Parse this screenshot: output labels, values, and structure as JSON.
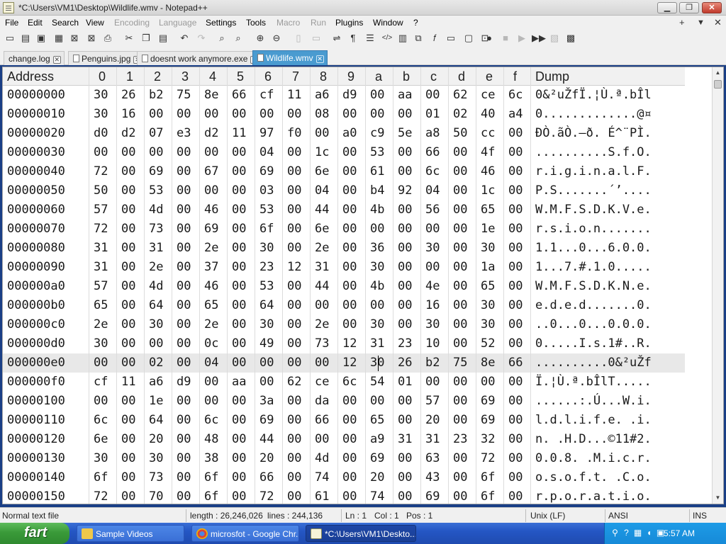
{
  "window": {
    "title": "*C:\\Users\\VM1\\Desktop\\Wildlife.wmv - Notepad++",
    "minimize_label": "▁",
    "restore_label": "❐",
    "close_label": "✕"
  },
  "menu": {
    "items": [
      "File",
      "Edit",
      "Search",
      "View",
      "Encoding",
      "Language",
      "Settings",
      "Tools",
      "Macro",
      "Run",
      "Plugins",
      "Window",
      "?"
    ],
    "disabled": [
      "Encoding",
      "Language",
      "Macro",
      "Run"
    ],
    "plus_label": "+",
    "dropdown_label": "▼",
    "close_label": "✕"
  },
  "toolbar": {
    "icons": [
      "new-file-icon",
      "open-file-icon",
      "save-icon",
      "save-all-icon",
      "close-icon",
      "close-all-icon",
      "print-icon",
      "cut-icon",
      "copy-icon",
      "paste-icon",
      "undo-icon",
      "redo-icon",
      "find-icon",
      "replace-icon",
      "zoom-in-icon",
      "zoom-out-icon",
      "sync-vertical-icon",
      "sync-horizontal-icon",
      "word-wrap-icon",
      "show-all-chars-icon",
      "indent-guide-icon",
      "xml-tag-icon",
      "document-map-icon",
      "function-list-icon",
      "folder-workspace-icon",
      "monitoring-icon",
      "fx-icon",
      "screen-icon",
      "record-macro-icon",
      "stop-record-icon",
      "play-macro-icon",
      "run-macro-multiple-icon",
      "save-macro-icon",
      "hex-editor-icon"
    ]
  },
  "tabs": [
    {
      "label": "change.log",
      "close": "✕"
    },
    {
      "label": "Penguins.jpg",
      "close": "✕"
    },
    {
      "label": "doesnt work anymore.exe",
      "close": "✕"
    },
    {
      "label": "Wildlife.wmv",
      "close": "✕"
    }
  ],
  "hex": {
    "header": {
      "address": "Address",
      "columns": [
        "0",
        "1",
        "2",
        "3",
        "4",
        "5",
        "6",
        "7",
        "8",
        "9",
        "a",
        "b",
        "c",
        "d",
        "e",
        "f"
      ],
      "dump": "Dump"
    },
    "rows": [
      {
        "addr": "00000000",
        "bytes": [
          "30",
          "26",
          "b2",
          "75",
          "8e",
          "66",
          "cf",
          "11",
          "a6",
          "d9",
          "00",
          "aa",
          "00",
          "62",
          "ce",
          "6c"
        ],
        "dump": "0&²uŽfÏ.¦Ù.ª.bÎl"
      },
      {
        "addr": "00000010",
        "bytes": [
          "30",
          "16",
          "00",
          "00",
          "00",
          "00",
          "00",
          "00",
          "08",
          "00",
          "00",
          "00",
          "01",
          "02",
          "40",
          "a4"
        ],
        "dump": "0.............@¤"
      },
      {
        "addr": "00000020",
        "bytes": [
          "d0",
          "d2",
          "07",
          "e3",
          "d2",
          "11",
          "97",
          "f0",
          "00",
          "a0",
          "c9",
          "5e",
          "a8",
          "50",
          "cc",
          "00"
        ],
        "dump": "ÐÒ.ãÒ.—ð. É^¨PÌ."
      },
      {
        "addr": "00000030",
        "bytes": [
          "00",
          "00",
          "00",
          "00",
          "00",
          "00",
          "04",
          "00",
          "1c",
          "00",
          "53",
          "00",
          "66",
          "00",
          "4f",
          "00"
        ],
        "dump": "..........S.f.O."
      },
      {
        "addr": "00000040",
        "bytes": [
          "72",
          "00",
          "69",
          "00",
          "67",
          "00",
          "69",
          "00",
          "6e",
          "00",
          "61",
          "00",
          "6c",
          "00",
          "46",
          "00"
        ],
        "dump": "r.i.g.i.n.a.l.F."
      },
      {
        "addr": "00000050",
        "bytes": [
          "50",
          "00",
          "53",
          "00",
          "00",
          "00",
          "03",
          "00",
          "04",
          "00",
          "b4",
          "92",
          "04",
          "00",
          "1c",
          "00"
        ],
        "dump": "P.S.......´’...."
      },
      {
        "addr": "00000060",
        "bytes": [
          "57",
          "00",
          "4d",
          "00",
          "46",
          "00",
          "53",
          "00",
          "44",
          "00",
          "4b",
          "00",
          "56",
          "00",
          "65",
          "00"
        ],
        "dump": "W.M.F.S.D.K.V.e."
      },
      {
        "addr": "00000070",
        "bytes": [
          "72",
          "00",
          "73",
          "00",
          "69",
          "00",
          "6f",
          "00",
          "6e",
          "00",
          "00",
          "00",
          "00",
          "00",
          "1e",
          "00"
        ],
        "dump": "r.s.i.o.n......."
      },
      {
        "addr": "00000080",
        "bytes": [
          "31",
          "00",
          "31",
          "00",
          "2e",
          "00",
          "30",
          "00",
          "2e",
          "00",
          "36",
          "00",
          "30",
          "00",
          "30",
          "00"
        ],
        "dump": "1.1...0...6.0.0."
      },
      {
        "addr": "00000090",
        "bytes": [
          "31",
          "00",
          "2e",
          "00",
          "37",
          "00",
          "23",
          "12",
          "31",
          "00",
          "30",
          "00",
          "00",
          "00",
          "1a",
          "00"
        ],
        "dump": "1...7.#.1.0....."
      },
      {
        "addr": "000000a0",
        "bytes": [
          "57",
          "00",
          "4d",
          "00",
          "46",
          "00",
          "53",
          "00",
          "44",
          "00",
          "4b",
          "00",
          "4e",
          "00",
          "65",
          "00"
        ],
        "dump": "W.M.F.S.D.K.N.e."
      },
      {
        "addr": "000000b0",
        "bytes": [
          "65",
          "00",
          "64",
          "00",
          "65",
          "00",
          "64",
          "00",
          "00",
          "00",
          "00",
          "00",
          "16",
          "00",
          "30",
          "00"
        ],
        "dump": "e.d.e.d.......0."
      },
      {
        "addr": "000000c0",
        "bytes": [
          "2e",
          "00",
          "30",
          "00",
          "2e",
          "00",
          "30",
          "00",
          "2e",
          "00",
          "30",
          "00",
          "30",
          "00",
          "30",
          "00"
        ],
        "dump": "..0...0...0.0.0."
      },
      {
        "addr": "000000d0",
        "bytes": [
          "30",
          "00",
          "00",
          "00",
          "0c",
          "00",
          "49",
          "00",
          "73",
          "12",
          "31",
          "23",
          "10",
          "00",
          "52",
          "00"
        ],
        "dump": "0.....I.s.1#..R."
      },
      {
        "addr": "000000e0",
        "bytes": [
          "00",
          "00",
          "02",
          "00",
          "04",
          "00",
          "00",
          "00",
          "00",
          "12",
          "30",
          "26",
          "b2",
          "75",
          "8e",
          "66"
        ],
        "dump": "..........0&²uŽf"
      },
      {
        "addr": "000000f0",
        "bytes": [
          "cf",
          "11",
          "a6",
          "d9",
          "00",
          "aa",
          "00",
          "62",
          "ce",
          "6c",
          "54",
          "01",
          "00",
          "00",
          "00",
          "00"
        ],
        "dump": "Ï.¦Ù.ª.bÎlT....."
      },
      {
        "addr": "00000100",
        "bytes": [
          "00",
          "00",
          "1e",
          "00",
          "00",
          "00",
          "3a",
          "00",
          "da",
          "00",
          "00",
          "00",
          "57",
          "00",
          "69",
          "00"
        ],
        "dump": "......:.Ú...W.i."
      },
      {
        "addr": "00000110",
        "bytes": [
          "6c",
          "00",
          "64",
          "00",
          "6c",
          "00",
          "69",
          "00",
          "66",
          "00",
          "65",
          "00",
          "20",
          "00",
          "69",
          "00"
        ],
        "dump": "l.d.l.i.f.e. .i."
      },
      {
        "addr": "00000120",
        "bytes": [
          "6e",
          "00",
          "20",
          "00",
          "48",
          "00",
          "44",
          "00",
          "00",
          "00",
          "a9",
          "31",
          "31",
          "23",
          "32",
          "00"
        ],
        "dump": "n. .H.D...©11#2."
      },
      {
        "addr": "00000130",
        "bytes": [
          "30",
          "00",
          "30",
          "00",
          "38",
          "00",
          "20",
          "00",
          "4d",
          "00",
          "69",
          "00",
          "63",
          "00",
          "72",
          "00"
        ],
        "dump": "0.0.8. .M.i.c.r."
      },
      {
        "addr": "00000140",
        "bytes": [
          "6f",
          "00",
          "73",
          "00",
          "6f",
          "00",
          "66",
          "00",
          "74",
          "00",
          "20",
          "00",
          "43",
          "00",
          "6f",
          "00"
        ],
        "dump": "o.s.o.f.t. .C.o."
      },
      {
        "addr": "00000150",
        "bytes": [
          "72",
          "00",
          "70",
          "00",
          "6f",
          "00",
          "72",
          "00",
          "61",
          "00",
          "74",
          "00",
          "69",
          "00",
          "6f",
          "00"
        ],
        "dump": "r.p.o.r.a.t.i.o."
      }
    ]
  },
  "status": {
    "filetype": "Normal text file",
    "length": "length : 26,246,026",
    "lines": "lines : 244,136",
    "ln": "Ln : 1",
    "col": "Col : 1",
    "pos": "Pos : 1",
    "eol": "Unix (LF)",
    "encoding": "ANSI",
    "mode": "INS"
  },
  "taskbar": {
    "start_label": "fart",
    "tasks": [
      "Sample Videos",
      "microsfot - Google Chr...",
      "*C:\\Users\\VM1\\Deskto..."
    ],
    "clock": "5:57 AM"
  }
}
